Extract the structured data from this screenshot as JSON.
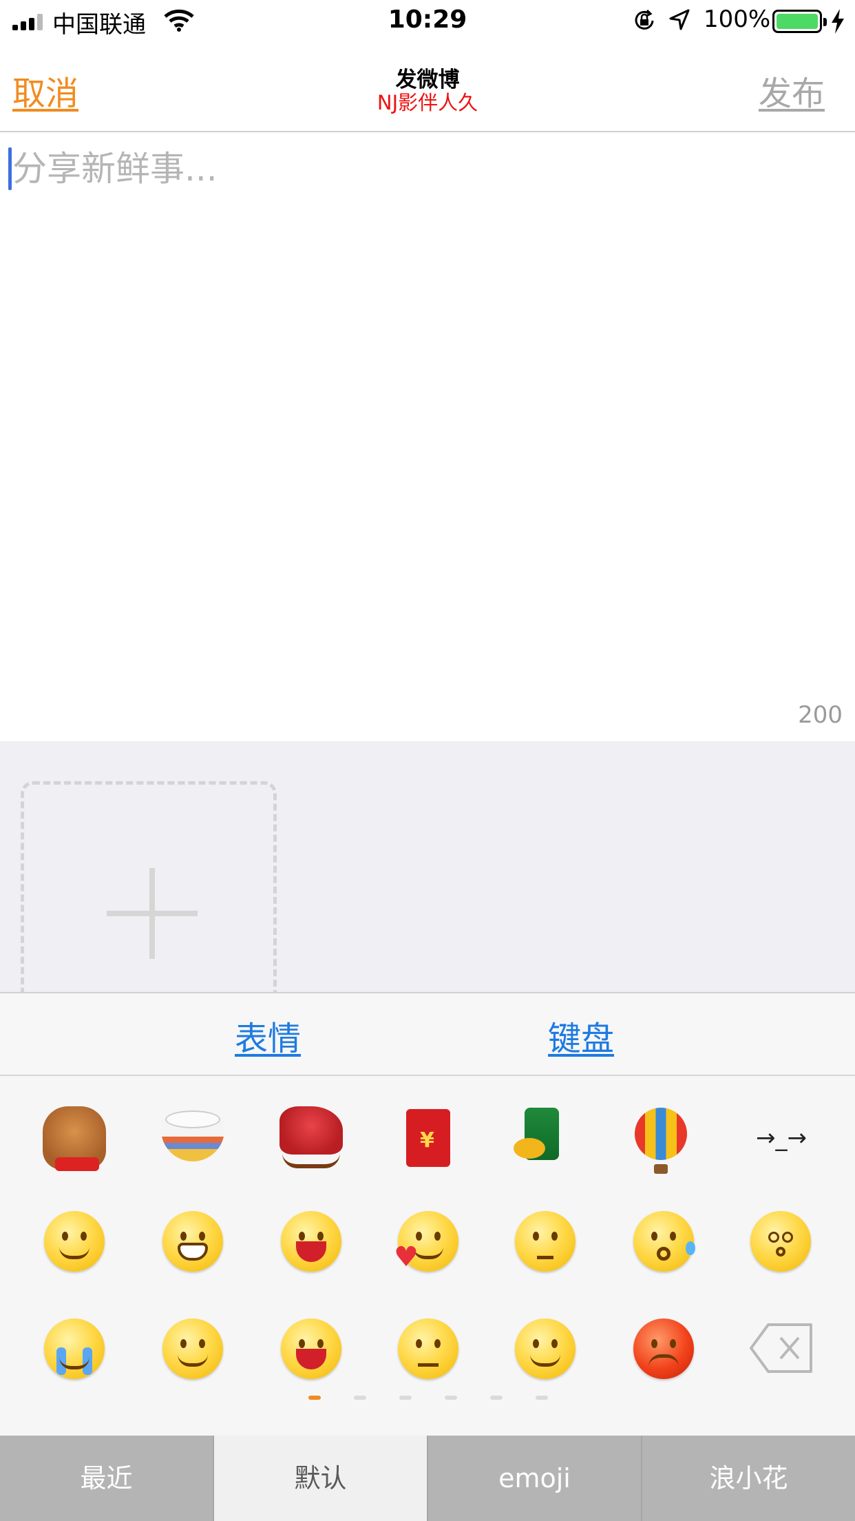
{
  "status_bar": {
    "carrier": "中国联通",
    "time": "10:29",
    "battery": "100%",
    "icons": [
      "signal-icon",
      "wifi-icon",
      "rotation-lock-icon",
      "location-icon",
      "battery-icon",
      "charging-bolt-icon"
    ]
  },
  "nav": {
    "cancel": "取消",
    "title": "发微博",
    "subtitle": "NJ影伴人久",
    "publish": "发布"
  },
  "compose": {
    "placeholder": "分享新鲜事...",
    "value": "",
    "remaining": "200"
  },
  "photos": {
    "add_icon": "plus-icon"
  },
  "toolbar": {
    "emoji": "表情",
    "keyboard": "键盘"
  },
  "emoji_panel": {
    "row1": [
      "horse",
      "tangyuan-bowl",
      "rocking-horse",
      "red-envelope",
      "beer-chicken",
      "hot-air-balloon",
      "→_→"
    ],
    "row2": [
      "smile",
      "grin",
      "laugh",
      "love-heart",
      "thinking",
      "surprised-sweat",
      "dizzy"
    ],
    "row3": [
      "crying",
      "tongue",
      "yawn",
      "annoyed",
      "shy-smile",
      "angry",
      "delete"
    ],
    "page_count": 6,
    "active_page": 0
  },
  "tabs": [
    "最近",
    "默认",
    "emoji",
    "浪小花"
  ],
  "active_tab": 1,
  "colors": {
    "accent": "#f28b1f",
    "link": "#1e7be0",
    "subtitle": "#ee1111",
    "caret": "#3d6fe0"
  }
}
